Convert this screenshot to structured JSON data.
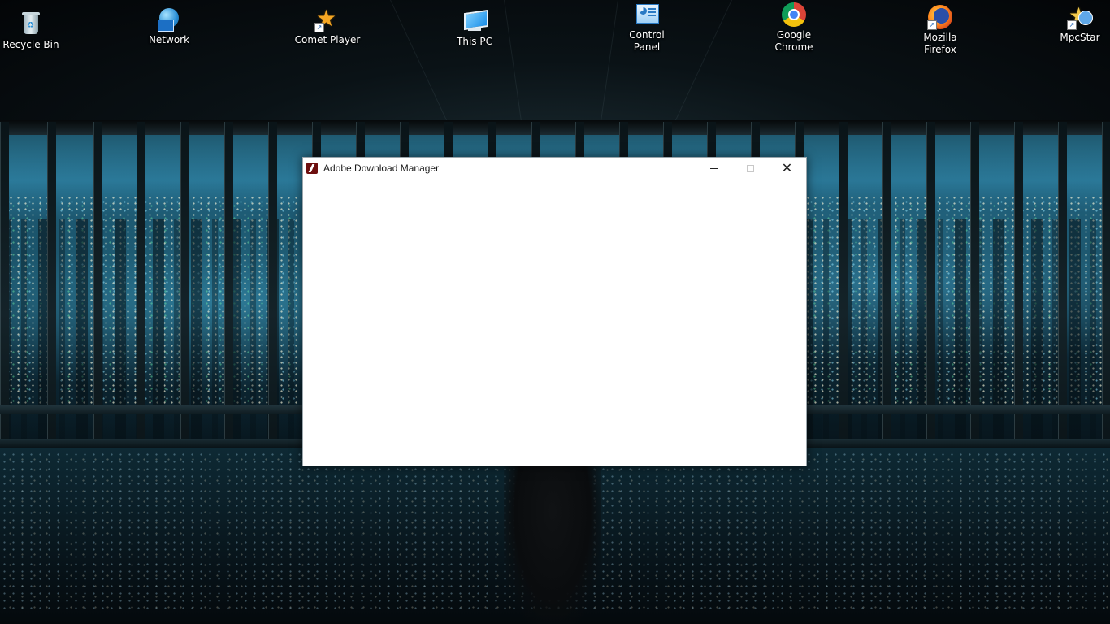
{
  "desktop": {
    "icons": [
      {
        "label": "Recycle Bin",
        "icon": "recycle-bin-icon"
      },
      {
        "label": "Network",
        "icon": "network-icon"
      },
      {
        "label": "Comet Player",
        "icon": "comet-player-icon"
      },
      {
        "label": "This PC",
        "icon": "this-pc-icon"
      },
      {
        "label": "Control\nPanel",
        "icon": "control-panel-icon"
      },
      {
        "label": "Google\nChrome",
        "icon": "chrome-icon"
      },
      {
        "label": "Mozilla\nFirefox",
        "icon": "firefox-icon"
      },
      {
        "label": "MpcStar",
        "icon": "mpcstar-icon"
      }
    ]
  },
  "window": {
    "title": "Adobe Download Manager",
    "app_icon": "adobe-icon",
    "controls": {
      "minimize": "minimize-icon",
      "maximize": "maximize-icon",
      "close": "close-icon"
    },
    "maximize_enabled": false
  },
  "colors": {
    "window_bg": "#ffffff",
    "adobe_icon": "#6d0f0f",
    "icon_label_text": "#ffffff"
  }
}
